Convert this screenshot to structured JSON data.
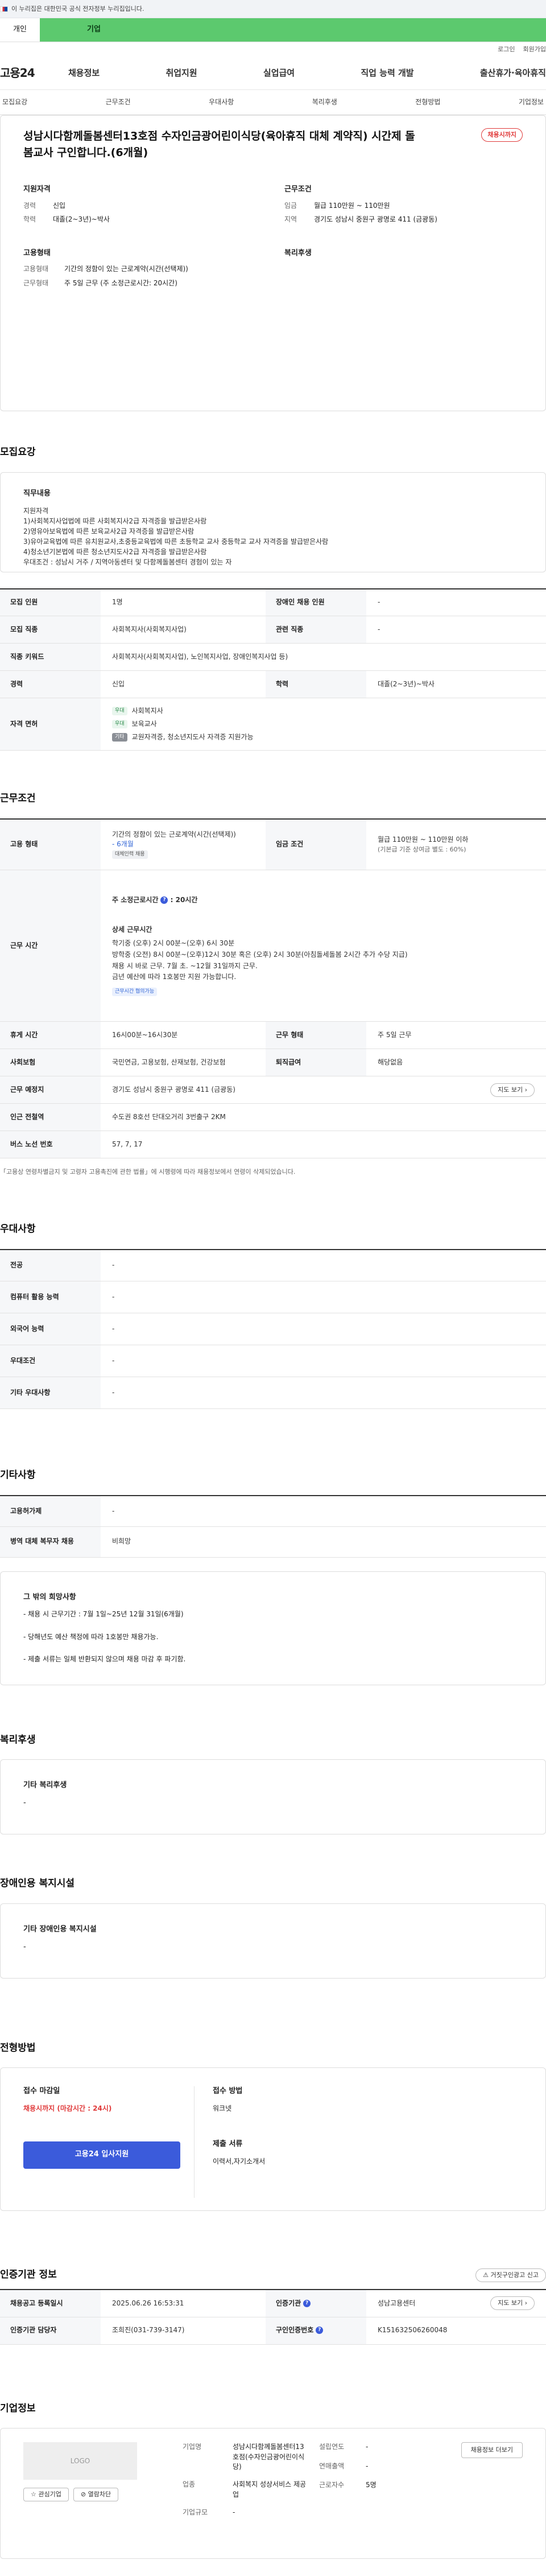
{
  "gov_banner": "이 누리집은 대한민국 공식 전자정부 누리집입니다.",
  "site_tabs": [
    "개인",
    "기업"
  ],
  "util": [
    "로그인",
    "회원가입"
  ],
  "logo": "고용24",
  "gnb": [
    "채용정보",
    "취업지원",
    "실업급여",
    "직업 능력 개발",
    "출산휴가·육아휴직"
  ],
  "anchor_tabs": [
    "모집요강",
    "근무조건",
    "우대사항",
    "복리후생",
    "전형방법",
    "기업정보"
  ],
  "title": "성남시다함께돌봄센터13호점 수자인금광어린이식당(육아휴직 대체 계약직) 시간제 돌봄교사 구인합니다.(6개월)",
  "status_badge": "채용시까지",
  "summary": {
    "qual": {
      "heading": "지원자격",
      "rows": [
        {
          "k": "경력",
          "v": "신입"
        },
        {
          "k": "학력",
          "v": "대졸(2~3년)~박사"
        }
      ]
    },
    "cond": {
      "heading": "근무조건",
      "rows": [
        {
          "k": "임금",
          "v": "월급 110만원 ~ 110만원"
        },
        {
          "k": "지역",
          "v": "경기도 성남시 중원구 광명로 411 (금광동)"
        }
      ]
    },
    "emp": {
      "heading": "고용형태",
      "rows": [
        {
          "k": "고용형태",
          "v": "기간의 정함이 있는 근로계약(시간(선택제))"
        },
        {
          "k": "근무형태",
          "v": "주 5일 근무 (주 소정근로시간: 20시간)"
        }
      ]
    },
    "welfare": {
      "heading": "복리후생"
    }
  },
  "recruit": {
    "section_title": "모집요강",
    "job_desc_heading": "직무내용",
    "job_desc": "지원자격\n1)사회복지사업법에 따른 사회복지사2급 자격증을 발급받은사람\n2)영유아보육법에 따른 보육교사2급 자격증을 발급받은사람\n3)유아교육법에 따른 유치원교사,초중등교육법에 따른 초등학교 교사 중등학교 교사 자격증을 발급받은사람\n4)청소년기본법에 따른 청소년지도사2급 자격증을 발급받은사람\n우대조건 : 성남시 거주 / 지역아동센터 및 다함께돌봄센터 경험이 있는 자",
    "table": {
      "headcount_k": "모집 인원",
      "headcount_v": "1명",
      "disabled_k": "장애인 채용 인원",
      "disabled_v": "-",
      "job_k": "모집 직종",
      "job_v": "사회복지사(사회복지사업)",
      "related_k": "관련 직종",
      "related_v": "-",
      "keyword_k": "직종 키워드",
      "keyword_v": "사회복지사(사회복지사업), 노인복지사업, 장애인복지사업 등)",
      "career_k": "경력",
      "career_v": "신입",
      "edu_k": "학력",
      "edu_v": "대졸(2~3년)~박사",
      "license_k": "자격 면허",
      "licenses": [
        {
          "tag": "우대",
          "name": "사회복지사"
        },
        {
          "tag": "우대",
          "name": "보육교사"
        },
        {
          "tag": "기타",
          "name": "교원자격증, 청소년지도사 자격증 지원가능"
        }
      ]
    }
  },
  "conditions": {
    "section_title": "근무조건",
    "emp_k": "고용 형태",
    "emp_v": "기간의 정함이 있는 근로계약(시간(선택제))",
    "emp_months": "- 6개월",
    "emp_tag": "대체인력 채용",
    "wage_k": "임금 조건",
    "wage_v": "월급 110만원 ~ 110만원 이하",
    "wage_sub": "(기본급 기준 상여금 별도 : 60%)",
    "hours_k": "근무 시간",
    "hours_weekly": "주 소정근로시간",
    "hours_weekly_v": ": 20시간",
    "hours_detail_title": "상세 근무시간",
    "hours_detail": "학기중 (오후) 2시 00분~(오후) 6시 30분\n방학중 (오전) 8시 00분~(오후)12시 30분 혹은 (오후) 2시 30분(아침돌세돌봄 2시간 추가 수당 지급)\n채용 시 바로 근무. 7월 초. ~12월 31일까지 근무.\n금년 예산에 따라 1호봉만 지원 가능합니다.",
    "hours_tag": "근무시간 협의가능",
    "break_k": "휴게 시간",
    "break_v": "16시00분~16시30분",
    "shift_k": "근무 형태",
    "shift_v": "주 5일 근무",
    "ins_k": "사회보험",
    "ins_v": "국민연금, 고용보험, 산재보험, 건강보험",
    "sev_k": "퇴직급여",
    "sev_v": "해당없음",
    "place_k": "근무 예정지",
    "place_v": "경기도 성남시 중원구 광명로 411 (금광동)",
    "map_btn": "지도 보기",
    "subway_k": "인근 전철역",
    "subway_v": "수도권 8호선 단대오거리 3번출구 2KM",
    "bus_k": "버스 노선 번호",
    "bus_v": "57, 7, 17",
    "note": "「고용상 연령차별금지 및 고령자 고용촉진에 관한 법률」에 시행령에 따라 채용정보에서 연령이 삭제되었습니다."
  },
  "preference": {
    "section_title": "우대사항",
    "rows": [
      {
        "k": "전공",
        "v": "-"
      },
      {
        "k": "컴퓨터 활용 능력",
        "v": "-"
      },
      {
        "k": "외국어 능력",
        "v": "-"
      },
      {
        "k": "우대조건",
        "v": "-"
      },
      {
        "k": "기타 우대사항",
        "v": "-"
      }
    ]
  },
  "other": {
    "section_title": "기타사항",
    "rows": [
      {
        "k": "고용허가제",
        "v": "-"
      },
      {
        "k": "병역 대체 복무자 채용",
        "v": "비희망"
      }
    ],
    "box_title": "그 밖의 희망사항",
    "box_lines": [
      "- 채용 시 근무기간 : 7월 1일~25년 12월 31일(6개월)",
      "- 당해년도 예산 책정에 따라 1호봉만 채용가능.",
      "- 제출 서류는 일체 반환되지 않으며 채용 마감 후 파기함."
    ]
  },
  "welfare": {
    "section_title": "복리후생",
    "box_title": "기타 복리후생",
    "box_value": "-"
  },
  "disabled": {
    "section_title": "장애인용 복지시설",
    "box_title": "기타 장애인용 복지시설",
    "box_value": "-"
  },
  "process": {
    "section_title": "전형방법",
    "deadline_k": "접수 마감일",
    "deadline_v": "채용시까지 (마감시간 : 24시)",
    "apply_btn": "고용24 입사지원",
    "method_k": "접수 방법",
    "method_v": "워크넷",
    "docs_k": "제출 서류",
    "docs_v": "이력서,자기소개서"
  },
  "agency": {
    "section_title": "인증기관 정보",
    "report_btn": "거짓구인광고 신고",
    "reg_k": "채용공고 등록일시",
    "reg_v": "2025.06.26 16:53:31",
    "inst_k": "인증기관",
    "inst_v": "성남고용센터",
    "map_btn": "지도 보기",
    "mgr_k": "인증기관 담당자",
    "mgr_v": "조희진(031-739-3147)",
    "id_k": "구인인증번호",
    "id_v": "K151632506260048"
  },
  "company": {
    "section_title": "기업정보",
    "logo_placeholder": "LOGO",
    "fav_btn": "관심기업",
    "block_btn": "열람차단",
    "name_k": "기업명",
    "name_v": "성남시다함께돌봄센터13호점(수자인금광어린이식당)",
    "industry_k": "업종",
    "industry_v": "사회복지 성상서비스 제공업",
    "size_k": "기업규모",
    "size_v": "-",
    "founded_k": "설립연도",
    "founded_v": "-",
    "revenue_k": "연매출액",
    "revenue_v": "-",
    "employees_k": "근로자수",
    "employees_v": "5명",
    "more_btn": "채용정보 더보기"
  }
}
